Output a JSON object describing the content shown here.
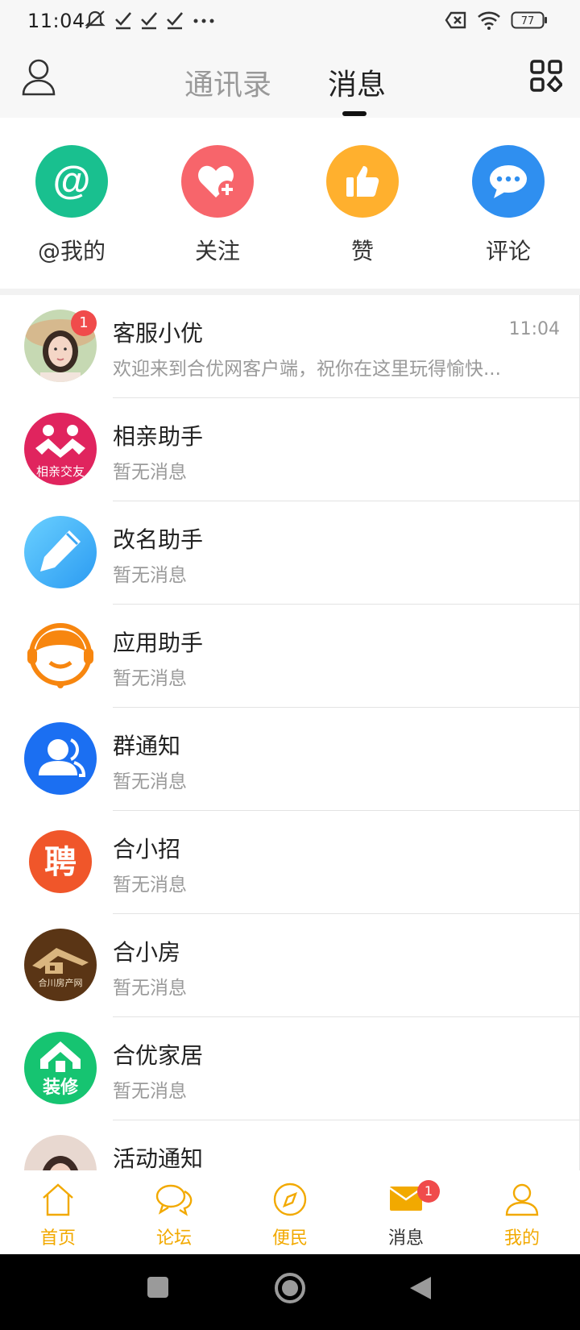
{
  "status_bar": {
    "time": "11:04",
    "battery": "77",
    "icons": [
      "mute-icon",
      "check-icon",
      "check-icon",
      "check-icon",
      "more-icon",
      "sim-off-icon",
      "wifi-icon",
      "battery-icon"
    ]
  },
  "top_nav": {
    "tabs": [
      {
        "label": "通讯录",
        "active": false
      },
      {
        "label": "消息",
        "active": true
      }
    ]
  },
  "quick_actions": [
    {
      "label": "@我的",
      "icon": "at-icon",
      "color": "#19c08f"
    },
    {
      "label": "关注",
      "icon": "heart-plus-icon",
      "color": "#f7656b"
    },
    {
      "label": "赞",
      "icon": "thumbs-up-icon",
      "color": "#ffb02e"
    },
    {
      "label": "评论",
      "icon": "chat-bubble-icon",
      "color": "#2f8ff0"
    }
  ],
  "messages": [
    {
      "name": "客服小优",
      "preview": "欢迎来到合优网客户端，祝你在这里玩得愉快...",
      "time": "11:04",
      "badge": "1"
    },
    {
      "name": "相亲助手",
      "preview": "暂无消息",
      "avatar_text": "相亲交友"
    },
    {
      "name": "改名助手",
      "preview": "暂无消息"
    },
    {
      "name": "应用助手",
      "preview": "暂无消息"
    },
    {
      "name": "群通知",
      "preview": "暂无消息"
    },
    {
      "name": "合小招",
      "preview": "暂无消息",
      "avatar_text": "聘"
    },
    {
      "name": "合小房",
      "preview": "暂无消息",
      "avatar_text": "合川房产网"
    },
    {
      "name": "合优家居",
      "preview": "暂无消息",
      "avatar_text": "装修"
    },
    {
      "name": "活动通知",
      "preview": ""
    }
  ],
  "bottom_tabs": [
    {
      "label": "首页",
      "icon": "home-icon"
    },
    {
      "label": "论坛",
      "icon": "forum-icon"
    },
    {
      "label": "便民",
      "icon": "compass-icon"
    },
    {
      "label": "消息",
      "icon": "mail-icon",
      "active": true,
      "badge": "1"
    },
    {
      "label": "我的",
      "icon": "person-icon"
    }
  ],
  "colors": {
    "accent": "#f2a900",
    "badge": "#f04b4b"
  }
}
